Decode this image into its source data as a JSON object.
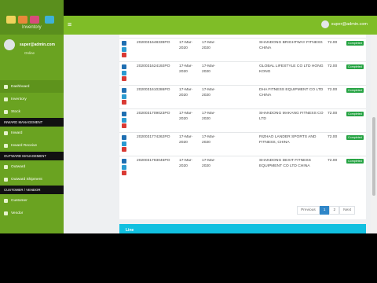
{
  "app": {
    "name": "Inventory"
  },
  "colors": {
    "primary_green": "#7fbd27",
    "sidebar_green": "#6aa321",
    "completed_badge": "#27a444",
    "line_chart_bar": "#11c0e0"
  },
  "header": {
    "menu_icon": "hamburger-icon",
    "user_email": "super@admin.com"
  },
  "sidebar": {
    "profile": {
      "email": "super@admin.com",
      "status": "Online"
    },
    "items": [
      {
        "type": "item",
        "label": "Dashboard",
        "icon": "dashboard-icon",
        "active": true
      },
      {
        "type": "item",
        "label": "Inventory",
        "icon": "box-icon"
      },
      {
        "type": "item",
        "label": "Stock",
        "icon": "stock-icon"
      },
      {
        "type": "header",
        "label": "INWARD MANAGEMENT"
      },
      {
        "type": "item",
        "label": "Inward",
        "icon": "inward-icon"
      },
      {
        "type": "item",
        "label": "Inward Receive",
        "icon": "receive-icon"
      },
      {
        "type": "header",
        "label": "OUTWARD MANAGEMENT"
      },
      {
        "type": "item",
        "label": "Outward",
        "icon": "outward-icon"
      },
      {
        "type": "item",
        "label": "Outward Shipment",
        "icon": "shipment-icon"
      },
      {
        "type": "header",
        "label": "CUSTOMER / VENDOR"
      },
      {
        "type": "item",
        "label": "Customer",
        "icon": "customer-icon"
      },
      {
        "type": "item",
        "label": "Vendor",
        "icon": "vendor-icon"
      }
    ]
  },
  "table": {
    "rows": [
      {
        "po": "2020031648339PO",
        "date1": "17-Mar-2020",
        "date2": "17-Mar-2020",
        "supplier": "SHANDONG BRIGHTWAY FITNESS CHINA",
        "amount": "72.00",
        "status": "Completed"
      },
      {
        "po": "2020031624192PO",
        "date1": "17-Mar-2020",
        "date2": "17-Mar-2020",
        "supplier": "GLOBAL LIFESTYLE CO LTD HONG KONG",
        "amount": "72.00",
        "status": "Completed"
      },
      {
        "po": "2020031610286PO",
        "date1": "17-Mar-2020",
        "date2": "17-Mar-2020",
        "supplier": "DHA FITNESS EQUIPMENT CO LTD CHINA",
        "amount": "72.00",
        "status": "Completed"
      },
      {
        "po": "2020031709023PO",
        "date1": "17-Mar-2020",
        "date2": "17-Mar-2020",
        "supplier": "SHANDONG MAKANG FITNESS CO LTD",
        "amount": "72.00",
        "status": "Completed"
      },
      {
        "po": "2020031774262PO",
        "date1": "17-Mar-2020",
        "date2": "17-Mar-2020",
        "supplier": "RIZHAO LANDER SPORTS AND FITNESS, CHINA",
        "amount": "72.00",
        "status": "Completed"
      },
      {
        "po": "2020031793046PO",
        "date1": "17-Mar-2020",
        "date2": "17-Mar-2020",
        "supplier": "SHANDONG DEXIT FITNESS EQUIPMENT CO LTD CHINA",
        "amount": "72.00",
        "status": "Completed"
      }
    ]
  },
  "pagination": {
    "previous": "Previous",
    "pages": [
      "1",
      "2"
    ],
    "current": "1",
    "next": "Next"
  },
  "line_chart": {
    "title": "Line"
  },
  "toolbar": {
    "icons": [
      "pause-icon",
      "cursor-icon",
      "pen-icon",
      "eraser-icon",
      "close-icon"
    ]
  }
}
